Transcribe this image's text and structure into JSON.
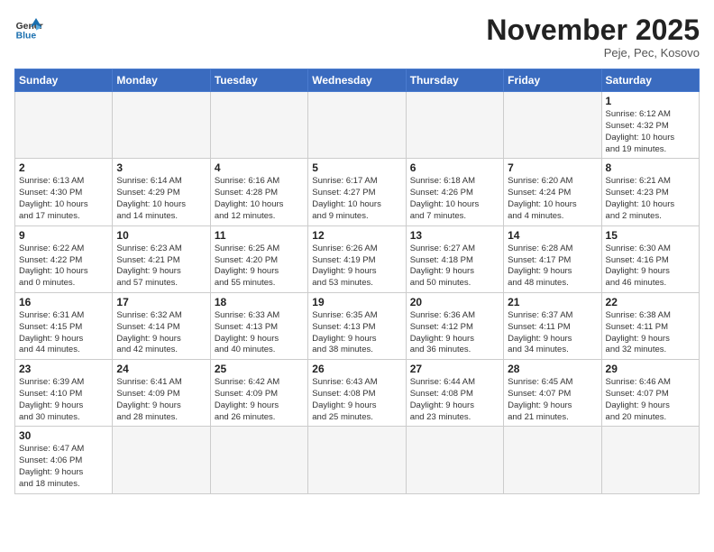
{
  "logo": {
    "text_general": "General",
    "text_blue": "Blue"
  },
  "title": "November 2025",
  "subtitle": "Peje, Pec, Kosovo",
  "header_days": [
    "Sunday",
    "Monday",
    "Tuesday",
    "Wednesday",
    "Thursday",
    "Friday",
    "Saturday"
  ],
  "weeks": [
    [
      {
        "day": "",
        "info": ""
      },
      {
        "day": "",
        "info": ""
      },
      {
        "day": "",
        "info": ""
      },
      {
        "day": "",
        "info": ""
      },
      {
        "day": "",
        "info": ""
      },
      {
        "day": "",
        "info": ""
      },
      {
        "day": "1",
        "info": "Sunrise: 6:12 AM\nSunset: 4:32 PM\nDaylight: 10 hours\nand 19 minutes."
      }
    ],
    [
      {
        "day": "2",
        "info": "Sunrise: 6:13 AM\nSunset: 4:30 PM\nDaylight: 10 hours\nand 17 minutes."
      },
      {
        "day": "3",
        "info": "Sunrise: 6:14 AM\nSunset: 4:29 PM\nDaylight: 10 hours\nand 14 minutes."
      },
      {
        "day": "4",
        "info": "Sunrise: 6:16 AM\nSunset: 4:28 PM\nDaylight: 10 hours\nand 12 minutes."
      },
      {
        "day": "5",
        "info": "Sunrise: 6:17 AM\nSunset: 4:27 PM\nDaylight: 10 hours\nand 9 minutes."
      },
      {
        "day": "6",
        "info": "Sunrise: 6:18 AM\nSunset: 4:26 PM\nDaylight: 10 hours\nand 7 minutes."
      },
      {
        "day": "7",
        "info": "Sunrise: 6:20 AM\nSunset: 4:24 PM\nDaylight: 10 hours\nand 4 minutes."
      },
      {
        "day": "8",
        "info": "Sunrise: 6:21 AM\nSunset: 4:23 PM\nDaylight: 10 hours\nand 2 minutes."
      }
    ],
    [
      {
        "day": "9",
        "info": "Sunrise: 6:22 AM\nSunset: 4:22 PM\nDaylight: 10 hours\nand 0 minutes."
      },
      {
        "day": "10",
        "info": "Sunrise: 6:23 AM\nSunset: 4:21 PM\nDaylight: 9 hours\nand 57 minutes."
      },
      {
        "day": "11",
        "info": "Sunrise: 6:25 AM\nSunset: 4:20 PM\nDaylight: 9 hours\nand 55 minutes."
      },
      {
        "day": "12",
        "info": "Sunrise: 6:26 AM\nSunset: 4:19 PM\nDaylight: 9 hours\nand 53 minutes."
      },
      {
        "day": "13",
        "info": "Sunrise: 6:27 AM\nSunset: 4:18 PM\nDaylight: 9 hours\nand 50 minutes."
      },
      {
        "day": "14",
        "info": "Sunrise: 6:28 AM\nSunset: 4:17 PM\nDaylight: 9 hours\nand 48 minutes."
      },
      {
        "day": "15",
        "info": "Sunrise: 6:30 AM\nSunset: 4:16 PM\nDaylight: 9 hours\nand 46 minutes."
      }
    ],
    [
      {
        "day": "16",
        "info": "Sunrise: 6:31 AM\nSunset: 4:15 PM\nDaylight: 9 hours\nand 44 minutes."
      },
      {
        "day": "17",
        "info": "Sunrise: 6:32 AM\nSunset: 4:14 PM\nDaylight: 9 hours\nand 42 minutes."
      },
      {
        "day": "18",
        "info": "Sunrise: 6:33 AM\nSunset: 4:13 PM\nDaylight: 9 hours\nand 40 minutes."
      },
      {
        "day": "19",
        "info": "Sunrise: 6:35 AM\nSunset: 4:13 PM\nDaylight: 9 hours\nand 38 minutes."
      },
      {
        "day": "20",
        "info": "Sunrise: 6:36 AM\nSunset: 4:12 PM\nDaylight: 9 hours\nand 36 minutes."
      },
      {
        "day": "21",
        "info": "Sunrise: 6:37 AM\nSunset: 4:11 PM\nDaylight: 9 hours\nand 34 minutes."
      },
      {
        "day": "22",
        "info": "Sunrise: 6:38 AM\nSunset: 4:11 PM\nDaylight: 9 hours\nand 32 minutes."
      }
    ],
    [
      {
        "day": "23",
        "info": "Sunrise: 6:39 AM\nSunset: 4:10 PM\nDaylight: 9 hours\nand 30 minutes."
      },
      {
        "day": "24",
        "info": "Sunrise: 6:41 AM\nSunset: 4:09 PM\nDaylight: 9 hours\nand 28 minutes."
      },
      {
        "day": "25",
        "info": "Sunrise: 6:42 AM\nSunset: 4:09 PM\nDaylight: 9 hours\nand 26 minutes."
      },
      {
        "day": "26",
        "info": "Sunrise: 6:43 AM\nSunset: 4:08 PM\nDaylight: 9 hours\nand 25 minutes."
      },
      {
        "day": "27",
        "info": "Sunrise: 6:44 AM\nSunset: 4:08 PM\nDaylight: 9 hours\nand 23 minutes."
      },
      {
        "day": "28",
        "info": "Sunrise: 6:45 AM\nSunset: 4:07 PM\nDaylight: 9 hours\nand 21 minutes."
      },
      {
        "day": "29",
        "info": "Sunrise: 6:46 AM\nSunset: 4:07 PM\nDaylight: 9 hours\nand 20 minutes."
      }
    ],
    [
      {
        "day": "30",
        "info": "Sunrise: 6:47 AM\nSunset: 4:06 PM\nDaylight: 9 hours\nand 18 minutes."
      },
      {
        "day": "",
        "info": ""
      },
      {
        "day": "",
        "info": ""
      },
      {
        "day": "",
        "info": ""
      },
      {
        "day": "",
        "info": ""
      },
      {
        "day": "",
        "info": ""
      },
      {
        "day": "",
        "info": ""
      }
    ]
  ]
}
